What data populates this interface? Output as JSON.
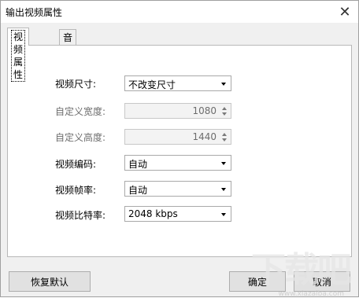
{
  "window": {
    "title": "输出视频属性",
    "close_glyph": "✕"
  },
  "tabs": [
    {
      "label": "视频属性",
      "active": true
    },
    {
      "label": "音频属性",
      "active": false
    }
  ],
  "fields": {
    "video_size": {
      "label": "视频尺寸:",
      "value": "不改变尺寸"
    },
    "custom_width": {
      "label": "自定义宽度:",
      "value": "1080"
    },
    "custom_height": {
      "label": "自定义高度:",
      "value": "1440"
    },
    "video_codec": {
      "label": "视频编码:",
      "value": "自动"
    },
    "frame_rate": {
      "label": "视频帧率:",
      "value": "自动"
    },
    "bitrate": {
      "label": "视频比特率:",
      "value": "2048 kbps"
    }
  },
  "buttons": {
    "reset": "恢复默认",
    "ok": "确定",
    "cancel": "取消"
  },
  "watermark": {
    "logo_text": "下载吧",
    "url": "www.xiazaiba.com"
  },
  "colors": {
    "background": "#f0f0f0",
    "panel": "#ffffff",
    "border": "#b8b8b8",
    "disabled_text": "#6d6d6d"
  }
}
